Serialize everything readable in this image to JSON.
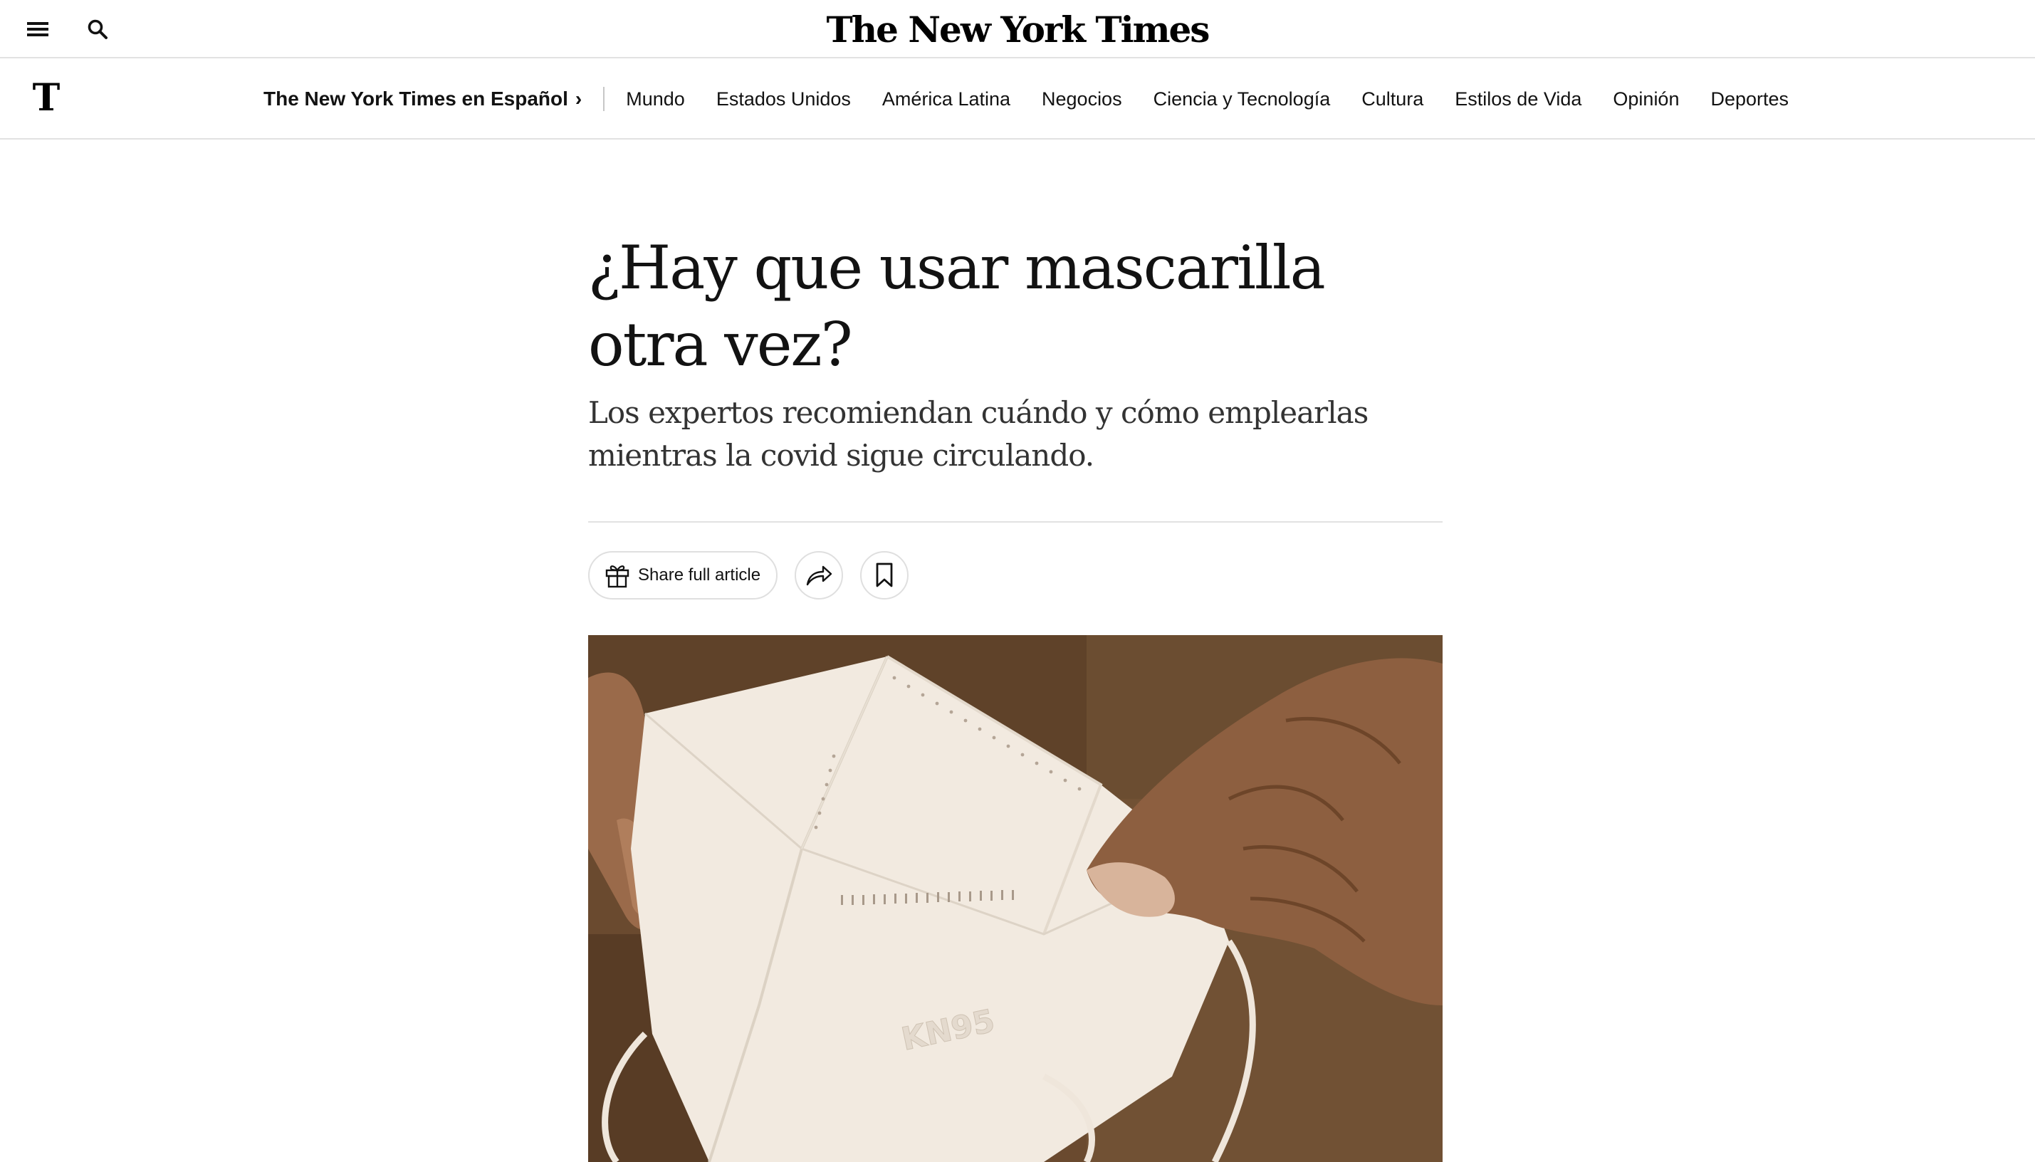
{
  "topbar": {
    "menu_icon": "menu-icon",
    "search_icon": "search-icon",
    "masthead": "The New York Times"
  },
  "nav": {
    "logo_glyph": "T",
    "home_label": "The New York Times en Español",
    "home_chevron": "›",
    "items": [
      {
        "label": "Mundo"
      },
      {
        "label": "Estados Unidos"
      },
      {
        "label": "América Latina"
      },
      {
        "label": "Negocios"
      },
      {
        "label": "Ciencia y Tecnología"
      },
      {
        "label": "Cultura"
      },
      {
        "label": "Estilos de Vida"
      },
      {
        "label": "Opinión"
      },
      {
        "label": "Deportes"
      }
    ]
  },
  "article": {
    "headline": "¿Hay que usar mascarilla otra vez?",
    "summary": "Los expertos recomiendan cuándo y cómo emplearlas mientras la covid sigue circulando.",
    "share_full_label": "Share full article",
    "share_icon": "share-arrow-icon",
    "bookmark_icon": "bookmark-icon",
    "gift_icon": "gift-icon",
    "image_mask_text": "KN95"
  }
}
